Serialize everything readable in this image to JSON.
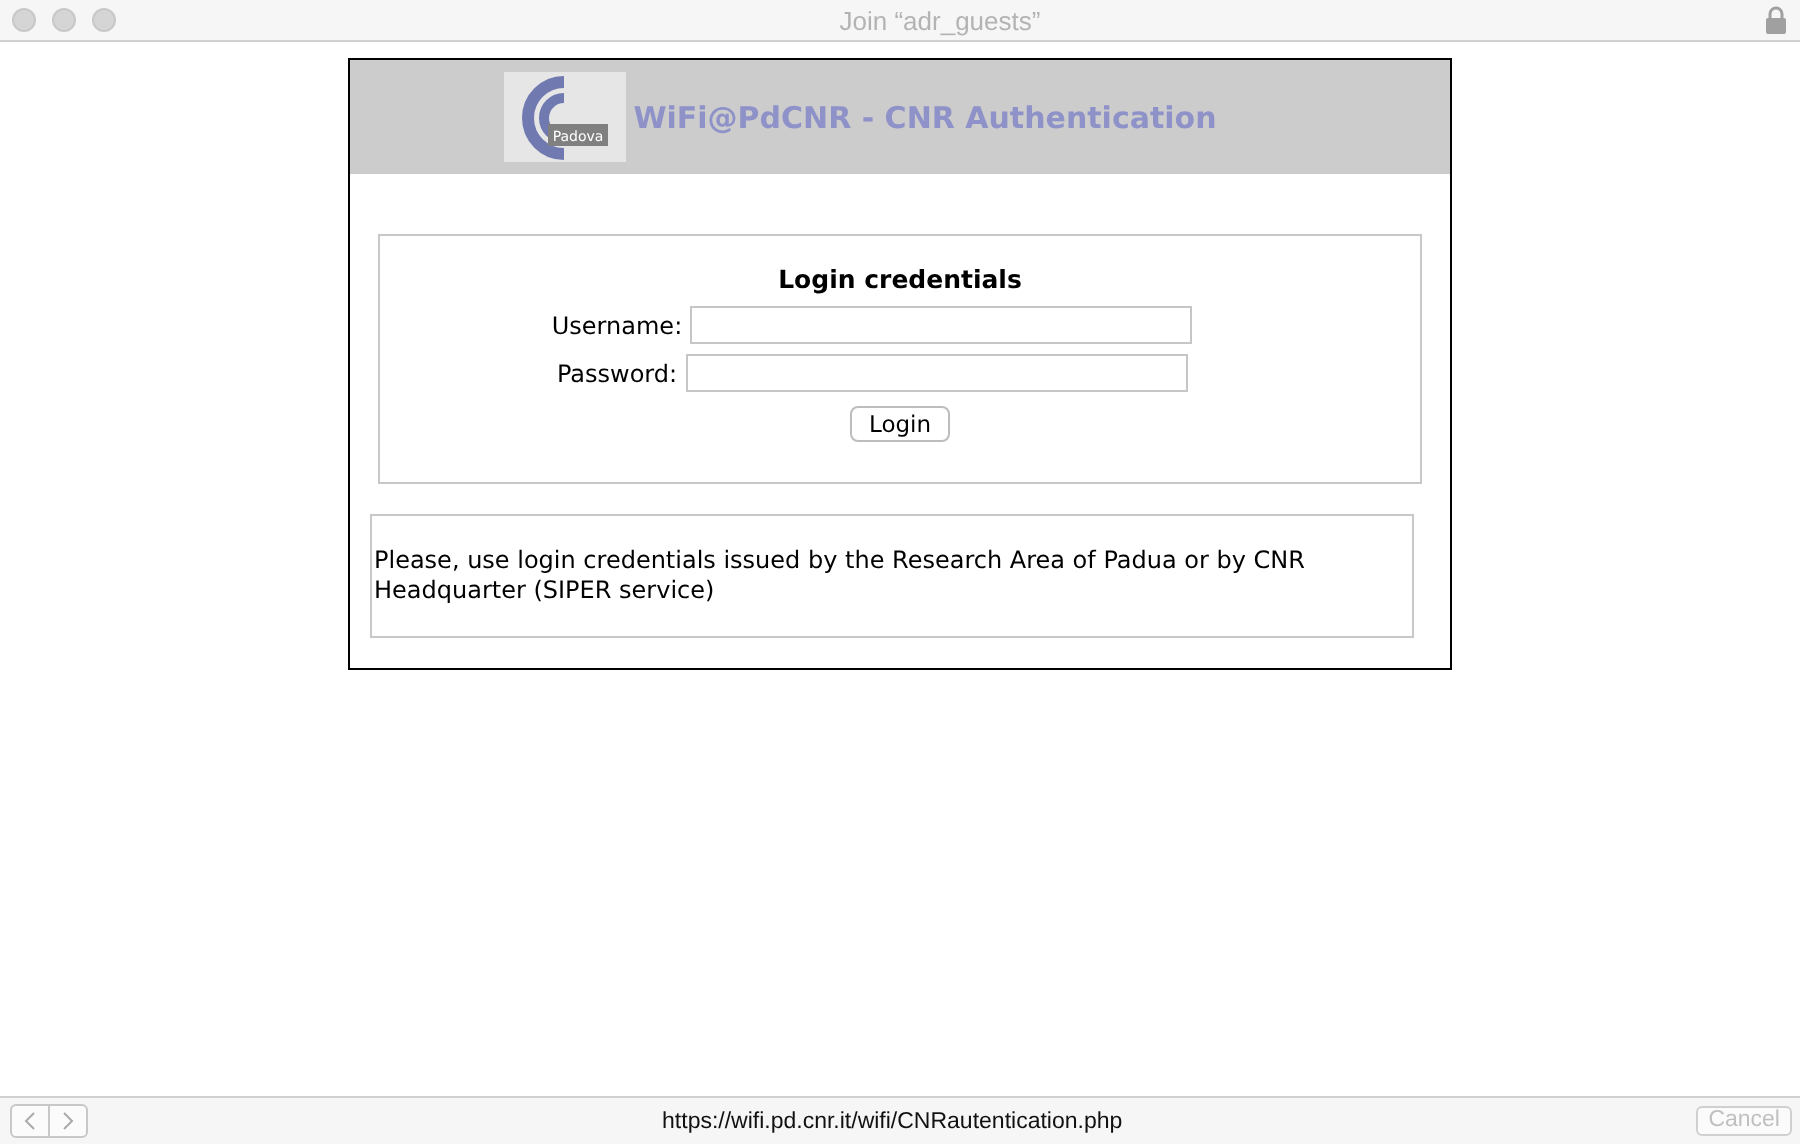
{
  "window": {
    "title": "Join “adr_guests”",
    "locked": true
  },
  "header": {
    "logo_text": "Padova",
    "title": "WiFi@PdCNR - CNR Authentication"
  },
  "login_form": {
    "heading": "Login credentials",
    "fields": [
      {
        "label": "Username:"
      },
      {
        "label": "Password:"
      }
    ],
    "button": "Login"
  },
  "notice": "Please, use login credentials issued by the Research Area of Padua or by CNR Headquarter (SIPER service)",
  "bottom_bar": {
    "url": "https://wifi.pd.cnr.it/wifi/CNRautentication.php",
    "cancel": {
      "label": "Cancel",
      "disabled": true
    }
  }
}
